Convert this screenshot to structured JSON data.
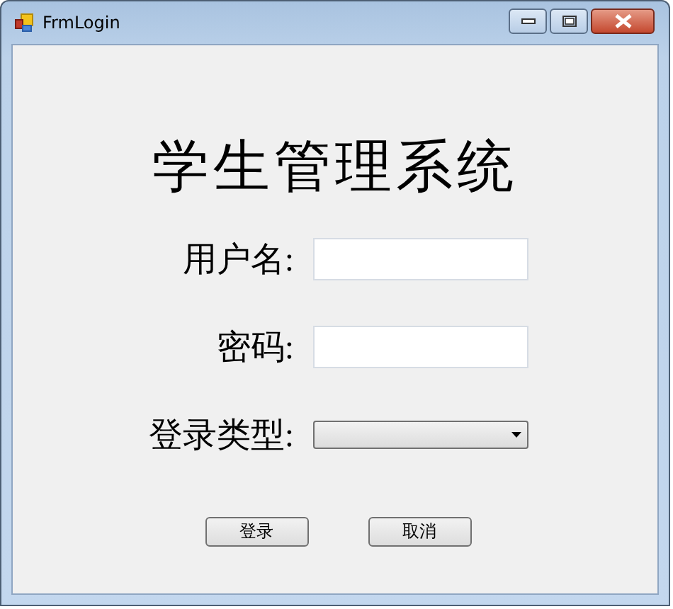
{
  "window": {
    "title": "FrmLogin"
  },
  "heading": "学生管理系统",
  "fields": [
    {
      "kind": "text",
      "label": "用户名:"
    },
    {
      "kind": "text",
      "label": "密码:"
    },
    {
      "kind": "dropdown",
      "label": "登录类型:"
    }
  ],
  "buttons": [
    "登录",
    "取消"
  ]
}
